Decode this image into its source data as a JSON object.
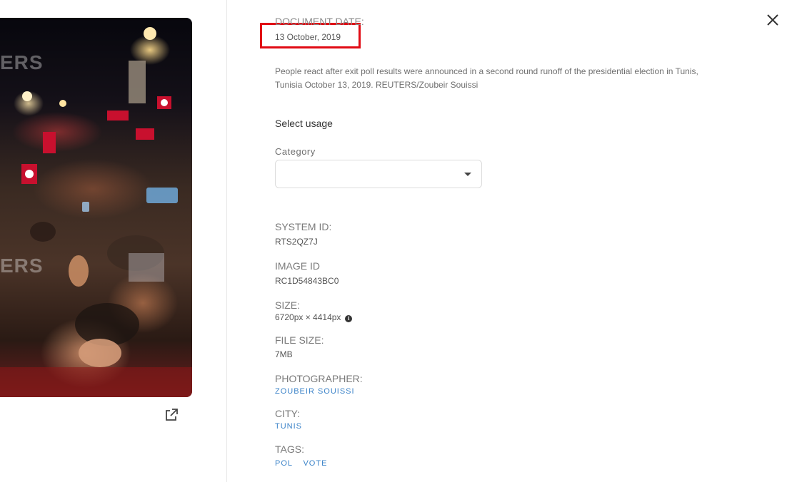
{
  "photo": {
    "watermark": "ERS",
    "alt_icon": "external-link-icon"
  },
  "close_icon": "close-icon",
  "document_date": {
    "label": "DOCUMENT DATE:",
    "value": "13 October, 2019"
  },
  "caption": "People react after exit poll results were announced in a second round runoff of the presidential election in Tunis, Tunisia October 13, 2019. REUTERS/Zoubeir Souissi",
  "usage": {
    "title": "Select usage",
    "category_label": "Category",
    "category_value": ""
  },
  "metadata": {
    "system_id_label": "SYSTEM ID:",
    "system_id": "RTS2QZ7J",
    "image_id_label": "IMAGE ID",
    "image_id": "RC1D54843BC0",
    "size_label": "SIZE:",
    "size": "6720px × 4414px",
    "file_size_label": "FILE SIZE:",
    "file_size": "7MB",
    "photographer_label": "PHOTOGRAPHER:",
    "photographer": "ZOUBEIR SOUISSI",
    "city_label": "CITY:",
    "city": "TUNIS",
    "tags_label": "TAGS:",
    "tags": [
      "POL",
      "VOTE"
    ]
  },
  "colors": {
    "highlight": "#e10b14",
    "link": "#3d84c9"
  }
}
